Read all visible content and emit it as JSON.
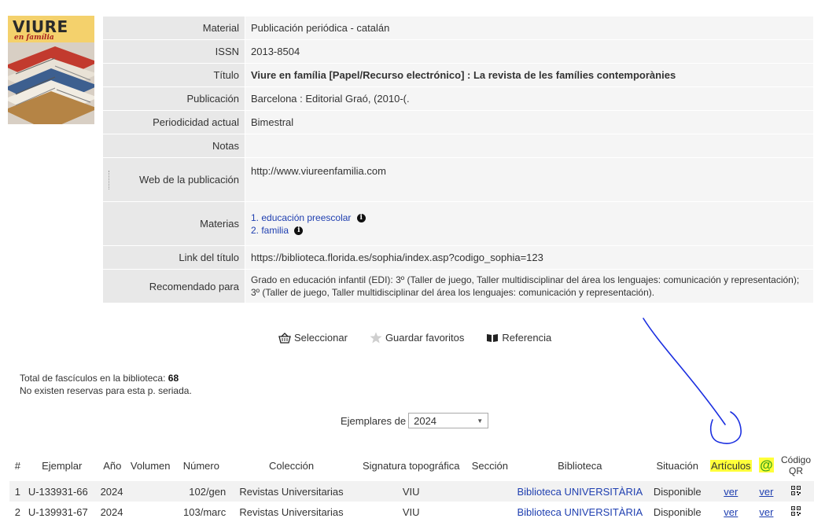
{
  "cover": {
    "title": "VIURE",
    "subtitle": "en família"
  },
  "record": {
    "material": {
      "label": "Material",
      "value": "Publicación periódica - catalán"
    },
    "issn": {
      "label": "ISSN",
      "value": "2013-8504"
    },
    "titulo": {
      "label": "Título",
      "value": "Viure en família [Papel/Recurso electrónico] : La revista de les famílies contemporànies"
    },
    "publicacion": {
      "label": "Publicación",
      "value": "Barcelona : Editorial Graó, (2010-(."
    },
    "periodicidad": {
      "label": "Periodicidad actual",
      "value": "Bimestral"
    },
    "notas": {
      "label": "Notas",
      "value": ""
    },
    "web": {
      "label": "Web de la publicación",
      "value": "http://www.viureenfamilia.com"
    },
    "materias": {
      "label": "Materias",
      "items": [
        "1. educación preescolar",
        "2. familia"
      ]
    },
    "link": {
      "label": "Link del título",
      "value": "https://biblioteca.florida.es/sophia/index.asp?codigo_sophia=123"
    },
    "recomendado": {
      "label": "Recomendado para",
      "value": "Grado en educación infantil (EDI): 3º (Taller de juego, Taller multidisciplinar del área los lenguajes: comunicación y representación); 3º (Taller de juego, Taller multidisciplinar del área los lenguajes: comunicación y representación)."
    }
  },
  "toolbar": {
    "select": "Seleccionar",
    "favorites": "Guardar favoritos",
    "reference": "Referencia"
  },
  "totals": {
    "line1_prefix": "Total de fascículos en la biblioteca: ",
    "line1_count": "68",
    "line2": "No existen reservas para esta p. seriada."
  },
  "ejemplares": {
    "label": "Ejemplares de",
    "selected": "2024"
  },
  "copies": {
    "headers": {
      "num": "#",
      "ejemplar": "Ejemplar",
      "anio": "Año",
      "volumen": "Volumen",
      "numero": "Número",
      "coleccion": "Colección",
      "signatura": "Signatura topográfica",
      "seccion": "Sección",
      "biblioteca": "Biblioteca",
      "situacion": "Situación",
      "articulos": "Artículos",
      "at": "@",
      "qr": "Código QR"
    },
    "rows": [
      {
        "n": "1",
        "ejemplar": "U-133931-66",
        "anio": "2024",
        "volumen": "",
        "numero": "102/gen",
        "coleccion": "Revistas Universitarias",
        "signatura": "VIU",
        "seccion": "",
        "biblioteca": "Biblioteca UNIVERSITÀRIA",
        "situacion": "Disponible",
        "articulos": "ver",
        "at": "ver"
      },
      {
        "n": "2",
        "ejemplar": "U-139931-67",
        "anio": "2024",
        "volumen": "",
        "numero": "103/marc",
        "coleccion": "Revistas Universitarias",
        "signatura": "VIU",
        "seccion": "",
        "biblioteca": "Biblioteca UNIVERSITÀRIA",
        "situacion": "Disponible",
        "articulos": "ver",
        "at": "ver"
      }
    ]
  },
  "colors": {
    "label_bg": "#e8e8e8",
    "value_bg": "#f5f5f5",
    "link": "#1f3fb0",
    "highlight": "#ffff3a",
    "at_icon": "#3aa31a",
    "annotation": "#1a2ee0",
    "cover_bg": "#f4d16c"
  }
}
